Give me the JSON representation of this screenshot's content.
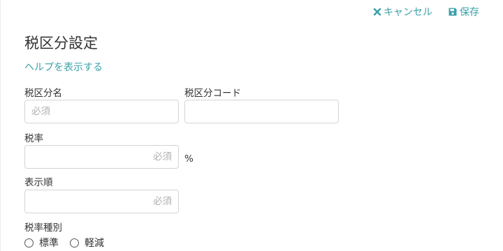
{
  "toolbar": {
    "cancel_label": "キャンセル",
    "save_label": "保存",
    "cancel_icon": "close-icon",
    "save_icon": "floppy-disk-icon",
    "accent_color": "#3aa0a8"
  },
  "page": {
    "title": "税区分設定",
    "help_link": "ヘルプを表示する"
  },
  "form": {
    "name": {
      "label": "税区分名",
      "placeholder": "必須",
      "value": ""
    },
    "code": {
      "label": "税区分コード",
      "placeholder": "",
      "value": ""
    },
    "rate": {
      "label": "税率",
      "placeholder": "必須",
      "value": "",
      "unit": "%"
    },
    "order": {
      "label": "表示順",
      "placeholder": "必須",
      "value": ""
    },
    "rate_type": {
      "label": "税率種別",
      "options": [
        "標準",
        "軽減"
      ],
      "selected": null
    }
  }
}
